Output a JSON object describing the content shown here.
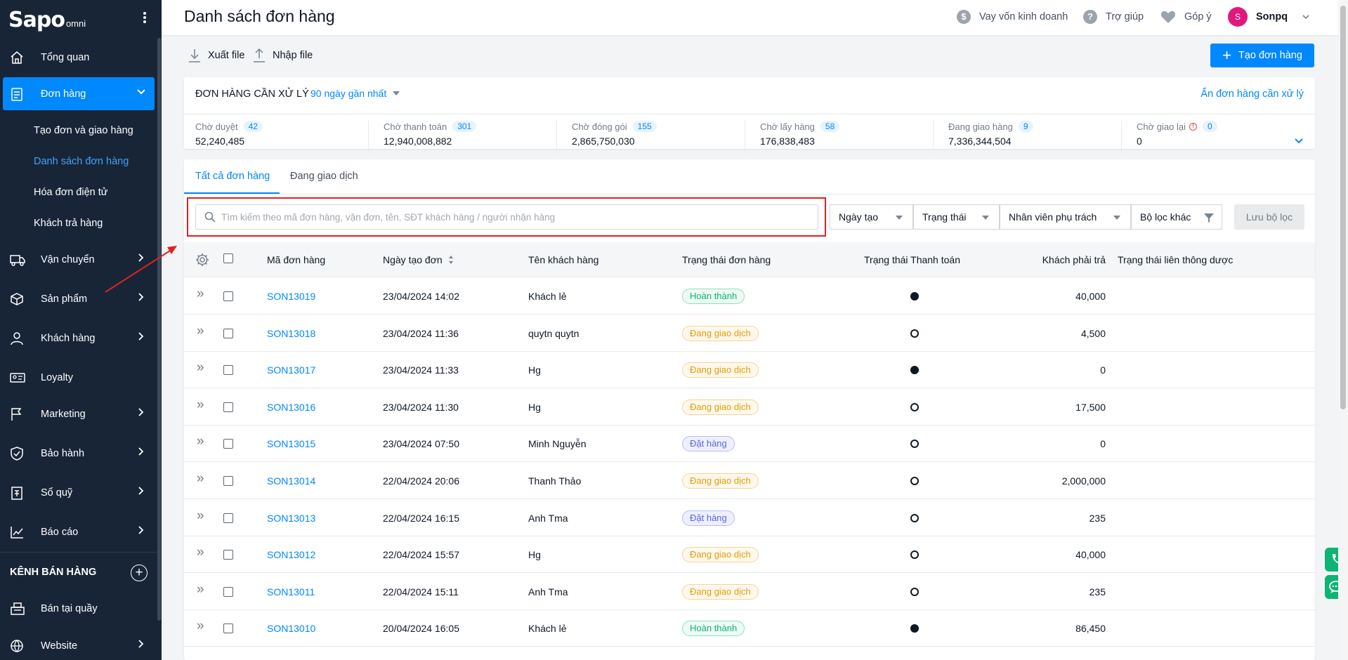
{
  "sidebar": {
    "logo_brand": "Sapo",
    "logo_suffix": "omni",
    "items": [
      {
        "label": "Tổng quan"
      },
      {
        "label": "Đơn hàng"
      },
      {
        "label": "Vận chuyển"
      },
      {
        "label": "Sản phẩm"
      },
      {
        "label": "Khách hàng"
      },
      {
        "label": "Loyalty"
      },
      {
        "label": "Marketing"
      },
      {
        "label": "Bảo hành"
      },
      {
        "label": "Sổ quỹ"
      },
      {
        "label": "Báo cáo"
      },
      {
        "label": "Bán tại quầy"
      },
      {
        "label": "Website"
      }
    ],
    "sub_items": [
      {
        "label": "Tạo đơn và giao hàng"
      },
      {
        "label": "Danh sách đơn hàng"
      },
      {
        "label": "Hóa đơn điện tử"
      },
      {
        "label": "Khách trả hàng"
      }
    ],
    "channel_heading": "KÊNH BÁN HÀNG",
    "channel_add": "+"
  },
  "header": {
    "title": "Danh sách đơn hàng",
    "loan": "Vay vốn kinh doanh",
    "help": "Trợ giúp",
    "feedback": "Góp ý",
    "user_initial": "S",
    "user_name": "Sonpq"
  },
  "toolbar": {
    "export": "Xuất file",
    "import": "Nhập file",
    "create": "Tạo đơn hàng"
  },
  "process": {
    "title": "ĐƠN HÀNG CẦN XỬ LÝ",
    "range": "90 ngày gần nhất",
    "hide": "Ẩn đơn hàng cần xử lý",
    "stats": [
      {
        "label": "Chờ duyệt",
        "count": "42",
        "amount": "52,240,485"
      },
      {
        "label": "Chờ thanh toán",
        "count": "301",
        "amount": "12,940,008,882"
      },
      {
        "label": "Chờ đóng gói",
        "count": "155",
        "amount": "2,865,750,030"
      },
      {
        "label": "Chờ lấy hàng",
        "count": "58",
        "amount": "176,838,483"
      },
      {
        "label": "Đang giao hàng",
        "count": "9",
        "amount": "7,336,344,504"
      },
      {
        "label": "Chờ giao lại",
        "count": "0",
        "amount": "0"
      }
    ]
  },
  "tabs": [
    {
      "label": "Tất cả đơn hàng"
    },
    {
      "label": "Đang giao dịch"
    }
  ],
  "search": {
    "placeholder": "Tìm kiếm theo mã đơn hàng, vận đơn, tên, SĐT khách hàng / người nhận hàng",
    "value": ""
  },
  "filters": {
    "date": "Ngày tạo",
    "status": "Trạng thái",
    "staff": "Nhân viên phụ trách",
    "other": "Bộ lọc khác",
    "save": "Lưu bộ lọc"
  },
  "table": {
    "columns": [
      "Mã đơn hàng",
      "Ngày tạo đơn",
      "Tên khách hàng",
      "Trạng thái đơn hàng",
      "Trạng thái Thanh toán",
      "Khách phải trả",
      "Trạng thái liên thông dược"
    ],
    "rows": [
      {
        "code": "SON13019",
        "date": "23/04/2024 14:02",
        "customer": "Khách lẻ",
        "status": "Hoàn thành",
        "status_type": "green",
        "paid": true,
        "amount": "40,000"
      },
      {
        "code": "SON13018",
        "date": "23/04/2024 11:36",
        "customer": "quytn quytn",
        "status": "Đang giao dịch",
        "status_type": "orange",
        "paid": false,
        "amount": "4,500"
      },
      {
        "code": "SON13017",
        "date": "23/04/2024 11:33",
        "customer": "Hg",
        "status": "Đang giao dịch",
        "status_type": "orange",
        "paid": true,
        "amount": "0"
      },
      {
        "code": "SON13016",
        "date": "23/04/2024 11:30",
        "customer": "Hg",
        "status": "Đang giao dịch",
        "status_type": "orange",
        "paid": false,
        "amount": "17,500"
      },
      {
        "code": "SON13015",
        "date": "23/04/2024 07:50",
        "customer": "Minh Nguyễn",
        "status": "Đặt hàng",
        "status_type": "purple",
        "paid": false,
        "amount": "0"
      },
      {
        "code": "SON13014",
        "date": "22/04/2024 20:06",
        "customer": "Thanh Thảo",
        "status": "Đang giao dịch",
        "status_type": "orange",
        "paid": false,
        "amount": "2,000,000"
      },
      {
        "code": "SON13013",
        "date": "22/04/2024 16:15",
        "customer": "Anh Tma",
        "status": "Đặt hàng",
        "status_type": "purple",
        "paid": false,
        "amount": "235"
      },
      {
        "code": "SON13012",
        "date": "22/04/2024 15:57",
        "customer": "Hg",
        "status": "Đang giao dịch",
        "status_type": "orange",
        "paid": false,
        "amount": "40,000"
      },
      {
        "code": "SON13011",
        "date": "22/04/2024 15:11",
        "customer": "Anh Tma",
        "status": "Đang giao dịch",
        "status_type": "orange",
        "paid": false,
        "amount": "235"
      },
      {
        "code": "SON13010",
        "date": "20/04/2024 16:05",
        "customer": "Khách lẻ",
        "status": "Hoàn thành",
        "status_type": "green",
        "paid": true,
        "amount": "86,450"
      }
    ]
  },
  "colors": {
    "accent": "#0088ff",
    "sidebar": "#182537",
    "highlight": "#e02020"
  }
}
